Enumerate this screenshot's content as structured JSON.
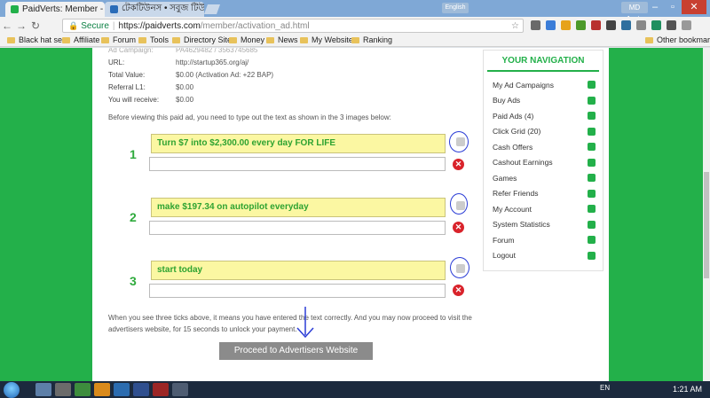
{
  "browser": {
    "tabs": [
      {
        "label": "PaidVerts: Member - Pai",
        "active": true
      },
      {
        "label": "টেকটিউনস • সবুজ টিউন টি",
        "active": false
      }
    ],
    "language_chip": "English",
    "profile_chip": "MD Jonis",
    "address": {
      "secure_label": "Secure",
      "host": "https://paidverts.com",
      "path": "/member/activation_ad.html"
    },
    "bookmarks": [
      "Black hat seo",
      "Affiliate",
      "Forum",
      "Tools",
      "Directory Site",
      "Money",
      "News",
      "My Website",
      "Ranking"
    ],
    "other_bookmarks": "Other bookmarks"
  },
  "ad_info": {
    "rows": [
      {
        "k": "Ad Campaign:",
        "v": "PA4629482 / 3563745685",
        "faded": true
      },
      {
        "k": "URL:",
        "v": "http://startup365.org/aj/"
      },
      {
        "k": "Total Value:",
        "v": "$0.00 (Activation Ad: +22 BAP)"
      },
      {
        "k": "Referral L1:",
        "v": "$0.00"
      },
      {
        "k": "You will receive:",
        "v": "$0.00"
      }
    ]
  },
  "instructions": "Before viewing this paid ad, you need to type out the text as shown in the 3 images below:",
  "captchas": [
    {
      "number": "1",
      "text": "Turn $7 into $2,300.00 every day FOR LIFE"
    },
    {
      "number": "2",
      "text": "make $197.34 on autopilot everyday"
    },
    {
      "number": "3",
      "text": "start today"
    }
  ],
  "bottom_text": "When you see three ticks above, it means you have entered the text correctly. And you may now proceed to visit the advertisers website, for 15 seconds to unlock your payment.",
  "proceed_label": "Proceed to Advertisers Website",
  "sidebar": {
    "title": "YOUR NAVIGATION",
    "items": [
      "My Ad Campaigns",
      "Buy Ads",
      "Paid Ads (4)",
      "Click Grid (20)",
      "Cash Offers",
      "Cashout Earnings",
      "Games",
      "Refer Friends",
      "My Account",
      "System Statistics",
      "Forum",
      "Logout"
    ]
  },
  "taskbar": {
    "lang": "EN",
    "time": "1:21 AM"
  },
  "colors": {
    "brand_green": "#23b04a",
    "captcha_bg": "#fbf7a2",
    "error_red": "#d9232b"
  }
}
